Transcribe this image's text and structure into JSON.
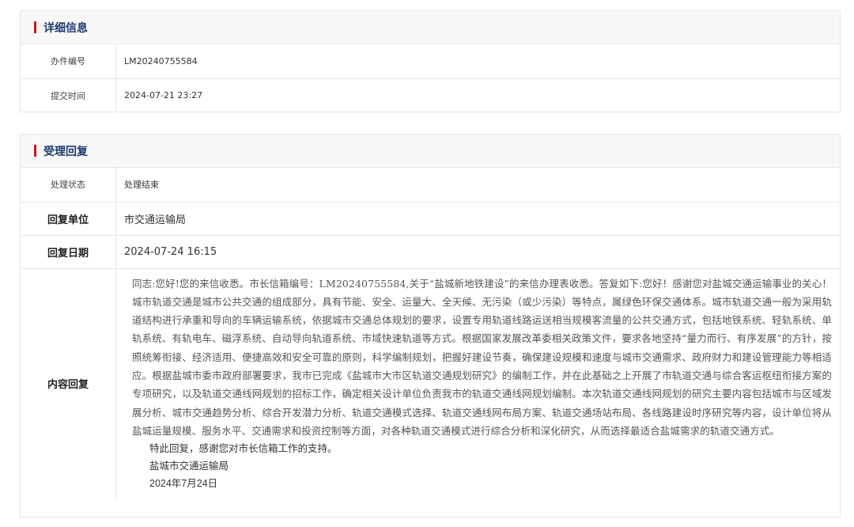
{
  "detail": {
    "header": "详细信息",
    "rows": [
      {
        "label": "办件编号",
        "value": "LM20240755584"
      },
      {
        "label": "提交时间",
        "value": "2024-07-21 23:27"
      }
    ]
  },
  "reply": {
    "header": "受理回复",
    "status_label": "处理状态",
    "status_value": "处理结束",
    "unit_label": "回复单位",
    "unit_value": "市交通运输局",
    "date_label": "回复日期",
    "date_value": "2024-07-24 16:15",
    "content_label": "内容回复",
    "content_text": "同志:您好!您的来信收悉。市长信箱编号：LM20240755584,关于“盐城新地铁建设”的来信办理表收悉。答复如下:您好！感谢您对盐城交通运输事业的关心！城市轨道交通是城市公共交通的组成部分，具有节能、安全、运量大、全天候、无污染（或少污染）等特点，属绿色环保交通体系。城市轨道交通一般为采用轨道结构进行承重和导向的车辆运输系统，依据城市交通总体规划的要求，设置专用轨道线路运送相当规模客流量的公共交通方式，包括地铁系统、轻轨系统、单轨系统、有轨电车、磁浮系统、自动导向轨道系统、市域快速轨道等方式。根据国家发展改革委相关政策文件，要求各地坚持“量力而行、有序发展”的方针，按照统筹衔接、经济适用、便捷高效和安全可靠的原则，科学编制规划，把握好建设节奏，确保建设规模和速度与城市交通需求、政府财力和建设管理能力等相适应。根据盐城市委市政府部署要求，我市已完成《盐城市大市区轨道交通规划研究》的编制工作，并在此基础之上开展了市轨道交通与综合客运枢纽衔接方案的专项研究，以及轨道交通线网规划的招标工作，确定相关设计单位负责我市的轨道交通线网规划编制。本次轨道交通线网规划的研究主要内容包括城市与区域发展分析、城市交通趋势分析、综合开发潜力分析、轨道交通模式选择、轨道交通线网布局方案、轨道交通场站布局、各线路建设时序研究等内容，设计单位将从盐城运量规模、服务水平、交通需求和投资控制等方面，对各种轨道交通模式进行综合分析和深化研究，从而选择最适合盐城需求的轨道交通方式。",
    "closing": "特此回复，感谢您对市长信箱工作的支持。",
    "signature_org": "盐城市交通运输局",
    "signature_date": "2024年7月24日"
  }
}
